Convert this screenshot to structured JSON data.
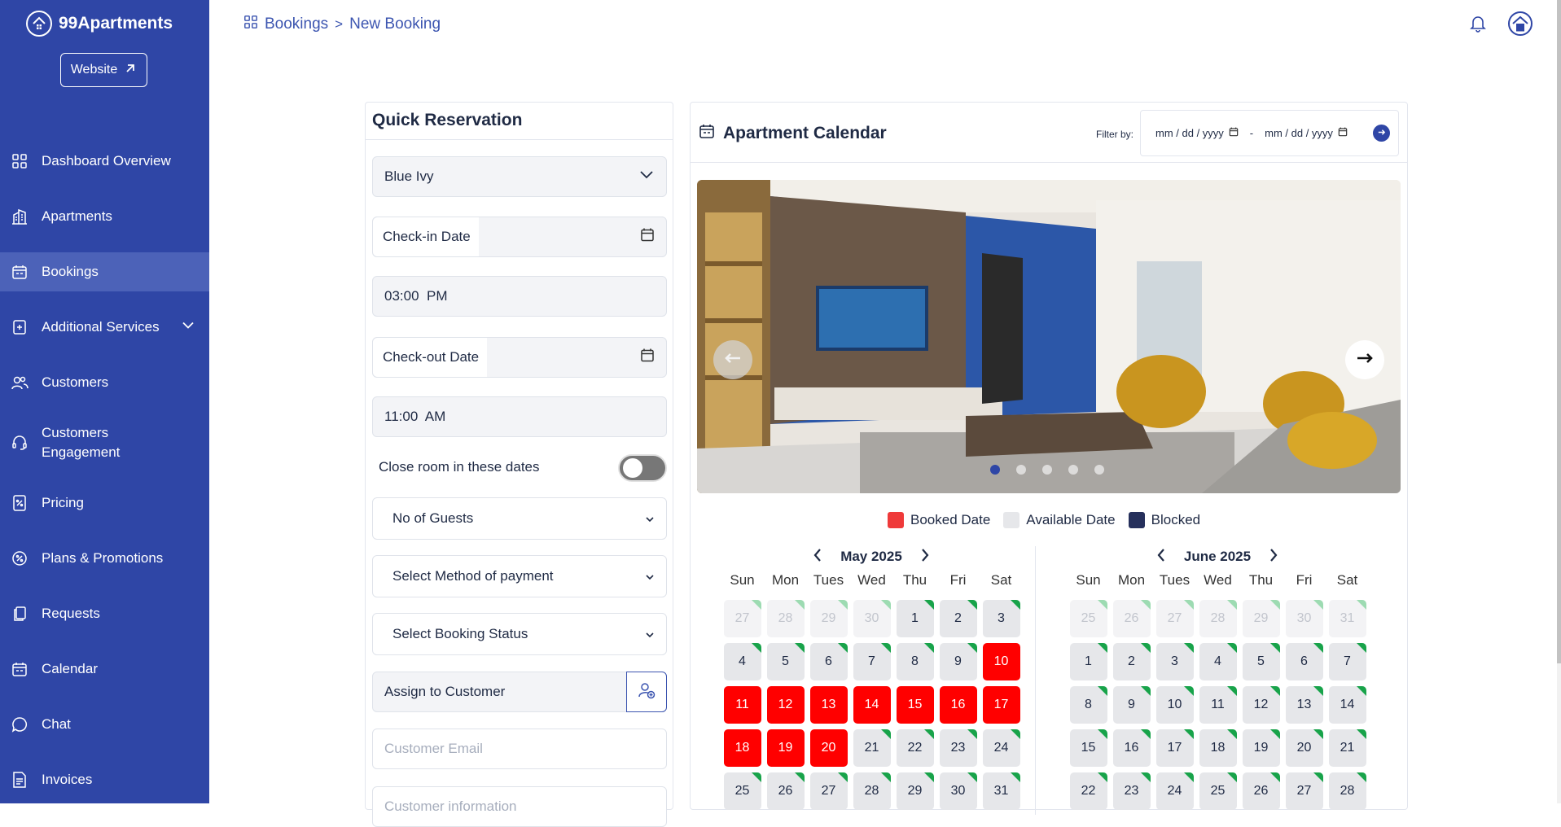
{
  "brand": {
    "name": "99Apartments",
    "website_label": "Website"
  },
  "sidebar": {
    "items": [
      {
        "label": "Dashboard Overview",
        "icon": "grid-icon"
      },
      {
        "label": "Apartments",
        "icon": "building-icon"
      },
      {
        "label": "Bookings",
        "icon": "calendar-icon",
        "active": true
      },
      {
        "label": "Additional Services",
        "icon": "plus-square-icon",
        "expandable": true
      },
      {
        "label": "Customers",
        "icon": "users-icon"
      },
      {
        "label": "Customers Engagement",
        "icon": "headset-icon"
      },
      {
        "label": "Pricing",
        "icon": "price-tag-icon"
      },
      {
        "label": "Plans & Promotions",
        "icon": "percent-badge-icon"
      },
      {
        "label": "Requests",
        "icon": "documents-icon"
      },
      {
        "label": "Calendar",
        "icon": "calendar-icon"
      },
      {
        "label": "Chat",
        "icon": "chat-bubble-icon"
      },
      {
        "label": "Invoices",
        "icon": "invoice-icon"
      }
    ]
  },
  "breadcrumb": {
    "root": "Bookings",
    "separator": ">",
    "current": "New Booking"
  },
  "quick_reservation": {
    "title": "Quick Reservation",
    "apartment": "Blue Ivy",
    "checkin_label": "Check-in Date",
    "checkin_time": "03:00  PM",
    "checkout_label": "Check-out Date",
    "checkout_time": "11:00  AM",
    "close_room_label": "Close room in these dates",
    "close_room_on": false,
    "guests_placeholder": "No of Guests",
    "payment_placeholder": "Select Method of payment",
    "status_placeholder": "Select Booking Status",
    "assign_label": "Assign to Customer",
    "email_placeholder": "Customer Email",
    "info_placeholder": "Customer information"
  },
  "calendar": {
    "title": "Apartment Calendar",
    "filter_label": "Filter by:",
    "date_from_placeholder": "mm / dd / yyyy",
    "date_to_placeholder": "mm / dd / yyyy",
    "date_sep": "-",
    "legend": [
      {
        "label": "Booked Date",
        "color": "#ef3a3a"
      },
      {
        "label": "Available Date",
        "color": "#e6e7ea"
      },
      {
        "label": "Blocked",
        "color": "#26305c"
      }
    ],
    "weekdays": [
      "Sun",
      "Mon",
      "Tues",
      "Wed",
      "Thu",
      "Fri",
      "Sat"
    ],
    "months": [
      {
        "name": "May 2025",
        "days": [
          {
            "d": "27",
            "t": "out"
          },
          {
            "d": "28",
            "t": "out"
          },
          {
            "d": "29",
            "t": "out"
          },
          {
            "d": "30",
            "t": "out"
          },
          {
            "d": "1",
            "t": "avail"
          },
          {
            "d": "2",
            "t": "avail"
          },
          {
            "d": "3",
            "t": "avail"
          },
          {
            "d": "4",
            "t": "avail"
          },
          {
            "d": "5",
            "t": "avail"
          },
          {
            "d": "6",
            "t": "avail"
          },
          {
            "d": "7",
            "t": "avail"
          },
          {
            "d": "8",
            "t": "avail"
          },
          {
            "d": "9",
            "t": "avail"
          },
          {
            "d": "10",
            "t": "booked"
          },
          {
            "d": "11",
            "t": "booked"
          },
          {
            "d": "12",
            "t": "booked"
          },
          {
            "d": "13",
            "t": "booked"
          },
          {
            "d": "14",
            "t": "booked"
          },
          {
            "d": "15",
            "t": "booked"
          },
          {
            "d": "16",
            "t": "booked"
          },
          {
            "d": "17",
            "t": "booked"
          },
          {
            "d": "18",
            "t": "booked"
          },
          {
            "d": "19",
            "t": "booked"
          },
          {
            "d": "20",
            "t": "booked"
          },
          {
            "d": "21",
            "t": "avail"
          },
          {
            "d": "22",
            "t": "avail"
          },
          {
            "d": "23",
            "t": "avail"
          },
          {
            "d": "24",
            "t": "avail"
          },
          {
            "d": "25",
            "t": "avail"
          },
          {
            "d": "26",
            "t": "avail"
          },
          {
            "d": "27",
            "t": "avail"
          },
          {
            "d": "28",
            "t": "avail"
          },
          {
            "d": "29",
            "t": "avail"
          },
          {
            "d": "30",
            "t": "avail"
          },
          {
            "d": "31",
            "t": "avail"
          }
        ]
      },
      {
        "name": "June 2025",
        "days": [
          {
            "d": "25",
            "t": "out"
          },
          {
            "d": "26",
            "t": "out"
          },
          {
            "d": "27",
            "t": "out"
          },
          {
            "d": "28",
            "t": "out"
          },
          {
            "d": "29",
            "t": "out"
          },
          {
            "d": "30",
            "t": "out"
          },
          {
            "d": "31",
            "t": "out"
          },
          {
            "d": "1",
            "t": "avail"
          },
          {
            "d": "2",
            "t": "avail"
          },
          {
            "d": "3",
            "t": "avail"
          },
          {
            "d": "4",
            "t": "avail"
          },
          {
            "d": "5",
            "t": "avail"
          },
          {
            "d": "6",
            "t": "avail"
          },
          {
            "d": "7",
            "t": "avail"
          },
          {
            "d": "8",
            "t": "avail"
          },
          {
            "d": "9",
            "t": "avail"
          },
          {
            "d": "10",
            "t": "avail"
          },
          {
            "d": "11",
            "t": "avail"
          },
          {
            "d": "12",
            "t": "avail"
          },
          {
            "d": "13",
            "t": "avail"
          },
          {
            "d": "14",
            "t": "avail"
          },
          {
            "d": "15",
            "t": "avail"
          },
          {
            "d": "16",
            "t": "avail"
          },
          {
            "d": "17",
            "t": "avail"
          },
          {
            "d": "18",
            "t": "avail"
          },
          {
            "d": "19",
            "t": "avail"
          },
          {
            "d": "20",
            "t": "avail"
          },
          {
            "d": "21",
            "t": "avail"
          },
          {
            "d": "22",
            "t": "avail"
          },
          {
            "d": "23",
            "t": "avail"
          },
          {
            "d": "24",
            "t": "avail"
          },
          {
            "d": "25",
            "t": "avail"
          },
          {
            "d": "26",
            "t": "avail"
          },
          {
            "d": "27",
            "t": "avail"
          },
          {
            "d": "28",
            "t": "avail"
          }
        ]
      }
    ],
    "carousel": {
      "slide_count": 5,
      "active_slide": 1
    }
  },
  "colors": {
    "sidebar": "#2f46a6",
    "accent": "#3c55b0",
    "booked": "#ff0000",
    "available": "#e6e7ea",
    "blocked": "#26305c",
    "corner": "#18a34a"
  }
}
